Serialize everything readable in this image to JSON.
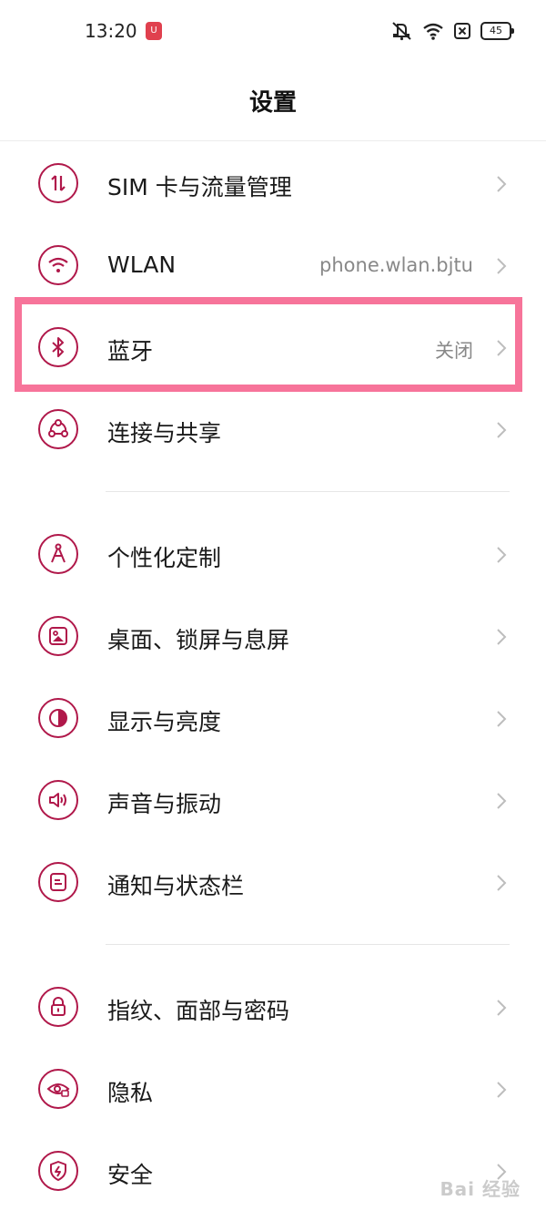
{
  "status_bar": {
    "time": "13:20",
    "app_badge": "U",
    "icons": [
      "mute-icon",
      "wifi-icon",
      "close-box-icon"
    ],
    "battery": "45"
  },
  "header": {
    "title": "设置"
  },
  "accent_color": "#b0184a",
  "highlight_color": "#f7749a",
  "groups": [
    {
      "items": [
        {
          "label": "SIM 卡与流量管理",
          "value": "",
          "icon": "sim-data-icon"
        },
        {
          "label": "WLAN",
          "value": "phone.wlan.bjtu",
          "icon": "wifi-icon"
        },
        {
          "label": "蓝牙",
          "value": "关闭",
          "icon": "bluetooth-icon"
        },
        {
          "label": "连接与共享",
          "value": "",
          "icon": "share-icon"
        }
      ]
    },
    {
      "items": [
        {
          "label": "个性化定制",
          "value": "",
          "icon": "compass-icon"
        },
        {
          "label": "桌面、锁屏与息屏",
          "value": "",
          "icon": "wallpaper-icon"
        },
        {
          "label": "显示与亮度",
          "value": "",
          "icon": "brightness-icon"
        },
        {
          "label": "声音与振动",
          "value": "",
          "icon": "speaker-icon"
        },
        {
          "label": "通知与状态栏",
          "value": "",
          "icon": "notification-icon"
        }
      ]
    },
    {
      "items": [
        {
          "label": "指纹、面部与密码",
          "value": "",
          "icon": "lock-icon"
        },
        {
          "label": "隐私",
          "value": "",
          "icon": "privacy-eye-icon"
        },
        {
          "label": "安全",
          "value": "",
          "icon": "shield-icon"
        }
      ]
    }
  ],
  "watermark": "Bai 经验"
}
